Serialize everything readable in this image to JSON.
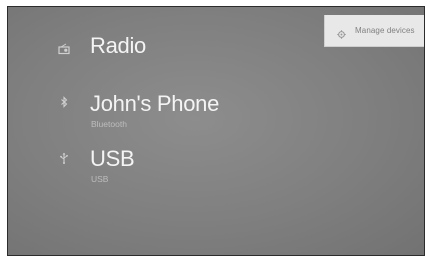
{
  "header": {
    "manage_devices_label": "Manage devices",
    "manage_devices_icon": "gear-icon"
  },
  "sources": [
    {
      "title": "Radio",
      "subtitle": "",
      "icon": "radio-icon"
    },
    {
      "title": "John's Phone",
      "subtitle": "Bluetooth",
      "icon": "bluetooth-icon"
    },
    {
      "title": "USB",
      "subtitle": "USB",
      "icon": "usb-icon"
    }
  ],
  "colors": {
    "background": "#808080",
    "title_text": "#f4f4f4",
    "subtitle_text": "#bdbdbd",
    "button_bg": "#e8e8e8",
    "button_text": "#808080"
  }
}
